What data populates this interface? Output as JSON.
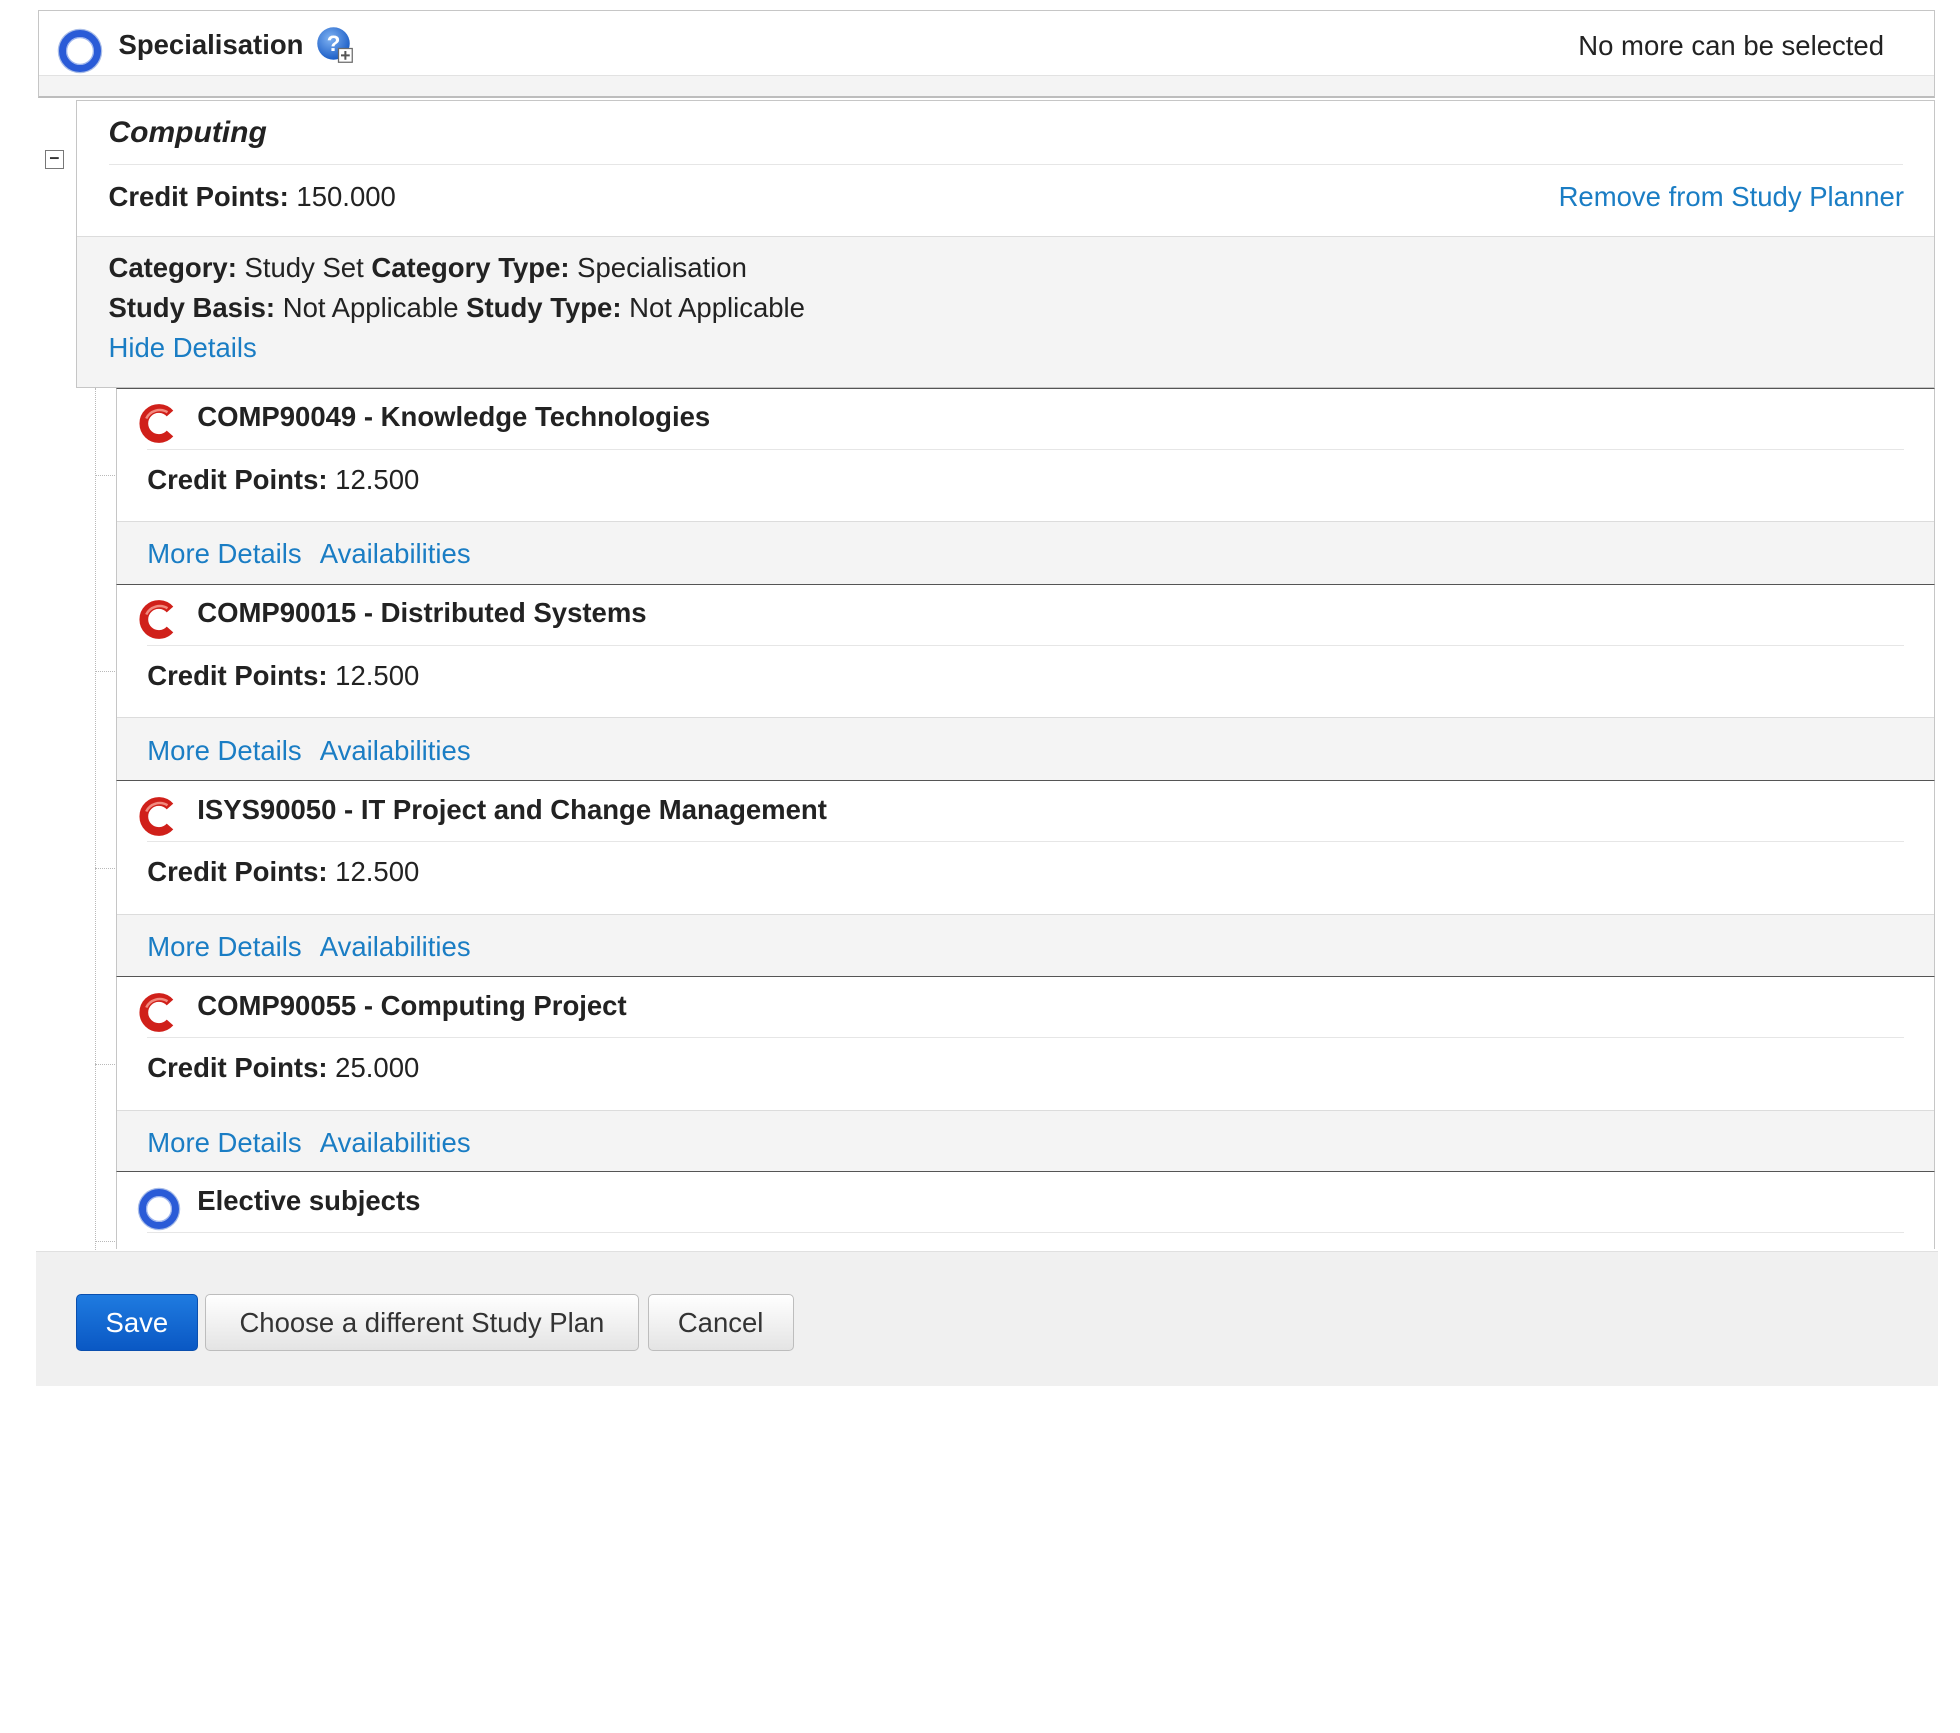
{
  "header": {
    "title": "Specialisation",
    "status": "No more can be selected",
    "icons": {
      "set": "ring-icon",
      "help": "help-add-icon"
    }
  },
  "study_set": {
    "name": "Computing",
    "credit_label": "Credit Points:",
    "credit_value": "150.000",
    "remove_link": "Remove from Study Planner",
    "category_label": "Category:",
    "category_value": "Study Set",
    "category_type_label": "Category Type:",
    "category_type_value": "Specialisation",
    "study_basis_label": "Study Basis:",
    "study_basis_value": "Not Applicable",
    "study_type_label": "Study Type:",
    "study_type_value": "Not Applicable",
    "hide_details": "Hide Details"
  },
  "subjects": [
    {
      "code_title": "COMP90049 - Knowledge Technologies",
      "credit_label": "Credit Points:",
      "credit_value": "12.500",
      "more_details": "More Details",
      "availabilities": "Availabilities"
    },
    {
      "code_title": "COMP90015 - Distributed Systems",
      "credit_label": "Credit Points:",
      "credit_value": "12.500",
      "more_details": "More Details",
      "availabilities": "Availabilities"
    },
    {
      "code_title": "ISYS90050 - IT Project and Change Management",
      "credit_label": "Credit Points:",
      "credit_value": "12.500",
      "more_details": "More Details",
      "availabilities": "Availabilities"
    },
    {
      "code_title": "COMP90055 - Computing Project",
      "credit_label": "Credit Points:",
      "credit_value": "25.000",
      "more_details": "More Details",
      "availabilities": "Availabilities"
    }
  ],
  "elective": {
    "name": "Elective subjects"
  },
  "footer": {
    "save": "Save",
    "choose": "Choose a different Study Plan",
    "cancel": "Cancel"
  },
  "colors": {
    "link": "#1a7dc4",
    "primary": "#0a58c4",
    "ring": "#2a5bd7",
    "course_icon": "#d0201a"
  }
}
